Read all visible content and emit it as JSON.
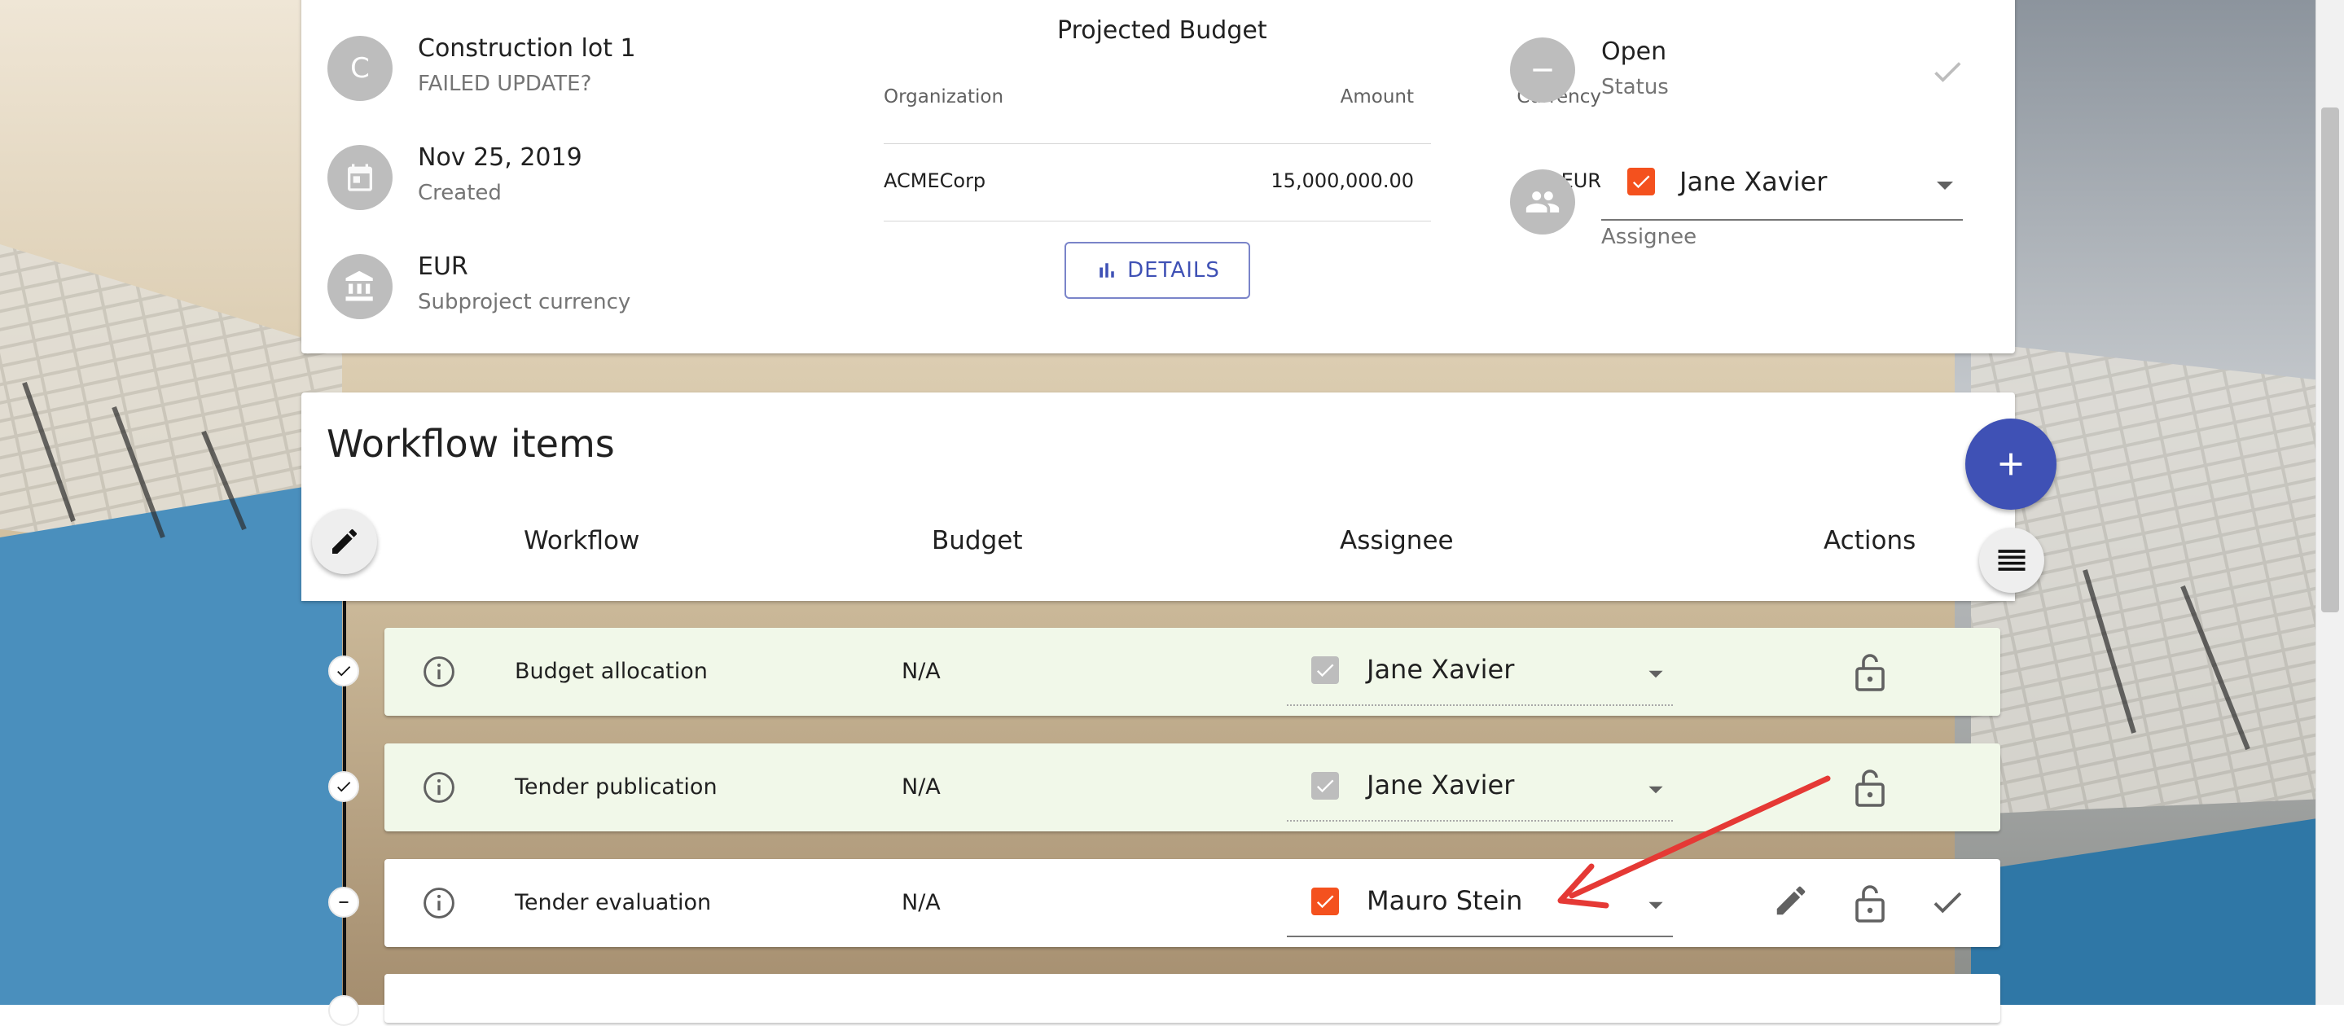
{
  "colors": {
    "primary": "#3f51b5",
    "checkbox_checked": "#f4511e",
    "checkbox_disabled": "#bdbdbd",
    "row_done_bg": "#f1f8e9",
    "annotation_arrow": "#e53935"
  },
  "subproject": {
    "avatar_letter": "C",
    "name": "Construction lot 1",
    "subtitle": "FAILED UPDATE?",
    "created_date": "Nov 25, 2019",
    "created_label": "Created",
    "currency": "EUR",
    "currency_label": "Subproject currency"
  },
  "budget": {
    "title": "Projected Budget",
    "headers": {
      "organization": "Organization",
      "amount": "Amount",
      "currency": "Currency"
    },
    "rows": [
      {
        "organization": "ACMECorp",
        "amount": "15,000,000.00",
        "currency": "EUR"
      }
    ],
    "details_button": "DETAILS"
  },
  "status": {
    "value": "Open",
    "label": "Status",
    "assignee": "Jane Xavier",
    "assignee_label": "Assignee"
  },
  "workflow": {
    "title": "Workflow items",
    "columns": {
      "workflow": "Workflow",
      "budget": "Budget",
      "assignee": "Assignee",
      "actions": "Actions"
    },
    "items": [
      {
        "name": "Budget allocation",
        "budget": "N/A",
        "assignee": "Jane Xavier",
        "status": "closed"
      },
      {
        "name": "Tender publication",
        "budget": "N/A",
        "assignee": "Jane Xavier",
        "status": "closed"
      },
      {
        "name": "Tender evaluation",
        "budget": "N/A",
        "assignee": "Mauro Stein",
        "status": "open"
      }
    ]
  },
  "icons": {
    "calendar": "calendar-icon",
    "bank": "bank-icon",
    "status": "minus-circle-icon",
    "people": "people-icon",
    "check": "check-icon",
    "add": "add-icon",
    "list": "list-icon",
    "edit": "edit-icon",
    "info": "info-icon",
    "lock": "lock-open-icon",
    "chart": "bar-chart-icon"
  }
}
